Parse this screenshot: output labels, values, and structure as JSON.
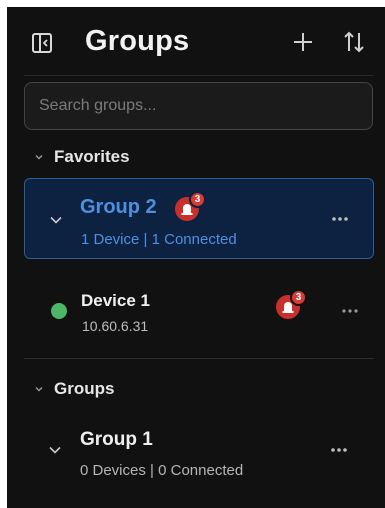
{
  "header": {
    "title": "Groups",
    "toggle_icon": "sidebar-toggle-icon",
    "add_icon": "plus-icon",
    "sort_icon": "sort-arrows-icon"
  },
  "search": {
    "placeholder": "Search groups...",
    "value": ""
  },
  "favorites": {
    "label": "Favorites",
    "groups": [
      {
        "name": "Group 2",
        "devices_text": "1 Device",
        "separator": "|",
        "connected_text": "1 Connected",
        "alarm_count": "3",
        "selected": true,
        "expanded": true
      }
    ],
    "devices": [
      {
        "name": "Device 1",
        "ip": "10.60.6.31",
        "status": "online",
        "alarm_count": "3"
      }
    ]
  },
  "groups_section": {
    "label": "Groups",
    "groups": [
      {
        "name": "Group 1",
        "devices_text": "0 Devices",
        "separator": "|",
        "connected_text": "0 Connected",
        "selected": false,
        "expanded": true
      }
    ]
  },
  "colors": {
    "background": "#111111",
    "accent": "#4f8fe0",
    "selected_bg": "#0d2240",
    "alarm": "#c9302c",
    "online": "#4cb866"
  }
}
